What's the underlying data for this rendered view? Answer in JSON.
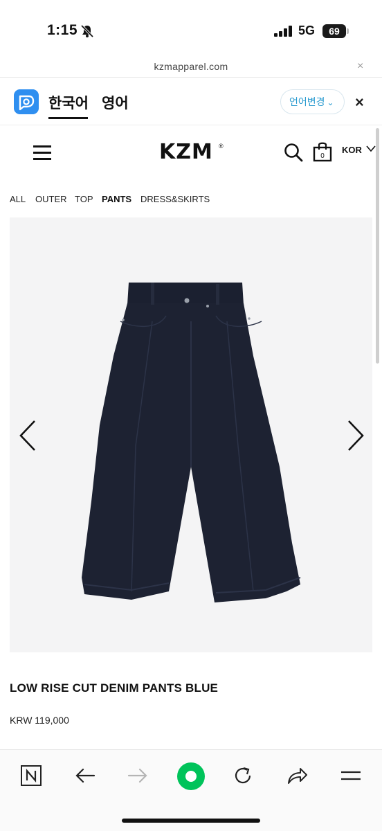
{
  "status_bar": {
    "time": "1:15",
    "network": "5G",
    "battery": "69"
  },
  "browser": {
    "url": "kzmapparel.com",
    "close_label": "×"
  },
  "translate_bar": {
    "tabs": [
      {
        "label": "한국어",
        "active": true
      },
      {
        "label": "영어",
        "active": false
      }
    ],
    "change_language_label": "언어변경",
    "close_label": "×"
  },
  "site_header": {
    "logo": "KZM",
    "logo_mark": "®",
    "language": "KOR",
    "cart_count": "0",
    "icons": [
      "menu-icon",
      "search-icon",
      "shopping-bag-icon",
      "chevron-down-icon"
    ]
  },
  "category_nav": {
    "items": [
      {
        "label": "ALL",
        "active": false
      },
      {
        "label": "OUTER",
        "active": false
      },
      {
        "label": "TOP",
        "active": false
      },
      {
        "label": "PANTS",
        "active": true
      },
      {
        "label": "DRESS&SKIRTS",
        "active": false
      }
    ]
  },
  "product": {
    "name": "LOW RISE CUT DENIM PANTS BLUE",
    "price": "KRW 119,000",
    "image_bg": "#f4f4f5",
    "denim_color": "#1b2030"
  },
  "bottom_toolbar": {
    "icons": [
      "naver-icon",
      "back-arrow-icon",
      "forward-arrow-icon",
      "green-dot-icon",
      "reload-icon",
      "share-icon",
      "menu-lines-icon"
    ],
    "accent": "#00c35a"
  }
}
